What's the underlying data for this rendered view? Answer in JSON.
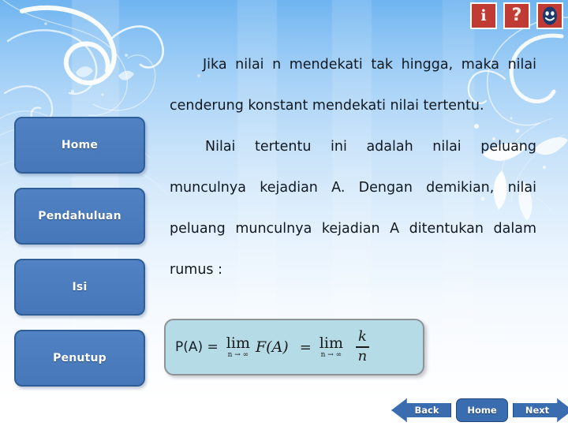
{
  "iconbar": {
    "info_label": "i",
    "help_label": "?",
    "face_label": ""
  },
  "sidebar": {
    "items": [
      {
        "label": "Home"
      },
      {
        "label": "Pendahuluan"
      },
      {
        "label": "Isi"
      },
      {
        "label": "Penutup"
      }
    ]
  },
  "content": {
    "paragraph1": "Jika nilai n mendekati tak hingga, maka nilai cenderung konstant mendekati nilai tertentu.",
    "paragraph2": "Nilai tertentu ini adalah nilai peluang munculnya kejadian A. Dengan demikian, nilai peluang munculnya kejadian A ditentukan dalam rumus :"
  },
  "formula": {
    "label": "P(A) =",
    "lim1": "lim",
    "lim1_sub": "n → ∞",
    "fa": "F(A)",
    "equals": "=",
    "lim2": "lim",
    "lim2_sub": "n → ∞",
    "numerator": "k",
    "denominator": "n"
  },
  "navigation": {
    "back_label": "Back",
    "home_label": "Home",
    "next_label": "Next"
  },
  "colors": {
    "sidebar_button": "#4a7cbe",
    "sidebar_border": "#2f5d97",
    "icon_red": "#bf3b34",
    "formula_fill": "#b5dce6",
    "formula_border": "#8f9296",
    "nav_button": "#3a6cb0",
    "text": "#111820",
    "background_top": "#6fb4f0",
    "background_bottom": "#ffffff"
  }
}
